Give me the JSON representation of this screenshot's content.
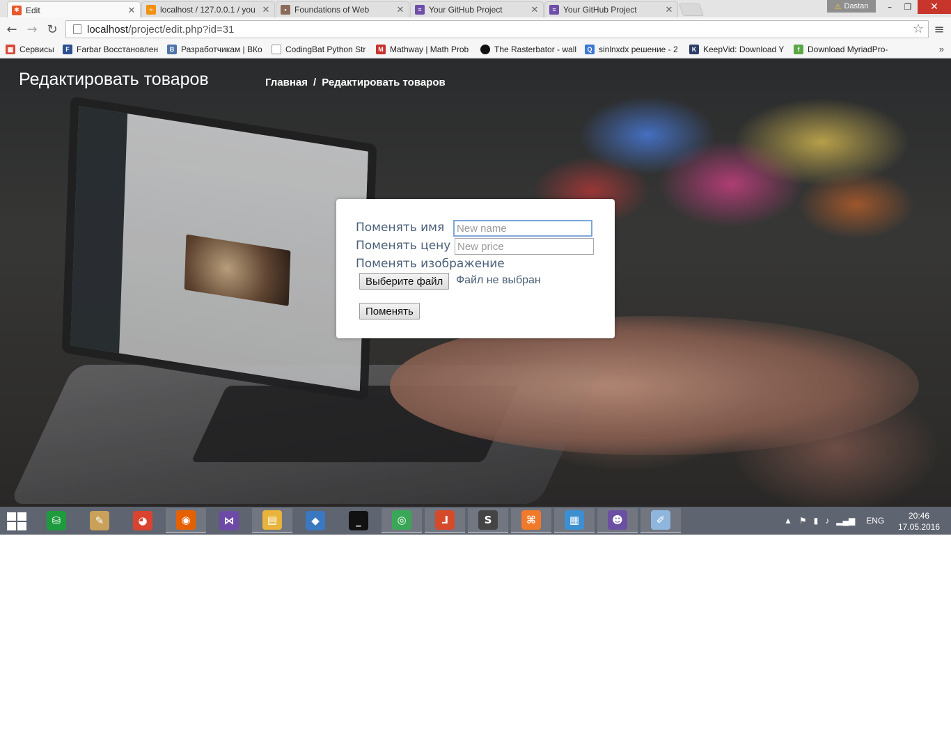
{
  "browser": {
    "tabs": [
      {
        "title": "Edit",
        "active": true,
        "favicon": "xampp-icon",
        "color": "#e8582a"
      },
      {
        "title": "localhost / 127.0.0.1 / you",
        "active": false,
        "favicon": "phpmyadmin-icon",
        "color": "#f29111"
      },
      {
        "title": "Foundations of Web",
        "active": false,
        "favicon": "course-icon",
        "color": "#8b6b5b"
      },
      {
        "title": "Your GitHub Project",
        "active": false,
        "favicon": "project-list-icon",
        "color": "#6f4ea8"
      },
      {
        "title": "Your GitHub Project",
        "active": false,
        "favicon": "project-list-icon",
        "color": "#6f4ea8"
      }
    ],
    "user_name": "Dastan",
    "address": {
      "host": "localhost",
      "path": "/project/edit.php?id=31"
    },
    "bookmarks": [
      {
        "label": "Сервисы",
        "icon": "apps-grid-icon",
        "color": "#d64a3a"
      },
      {
        "label": "Farbar Восстановлен",
        "icon": "bookmark-farbar-icon",
        "color": "#2b4f91"
      },
      {
        "label": "Разработчикам | ВКо",
        "icon": "vk-icon",
        "color": "#4f74a8"
      },
      {
        "label": "CodingBat Python Str",
        "icon": "page-icon",
        "color": "#aaaaaa"
      },
      {
        "label": "Mathway | Math Prob",
        "icon": "mathway-icon",
        "color": "#c8312c"
      },
      {
        "label": "The Rasterbator - wall",
        "icon": "rasterbator-icon",
        "color": "#111111"
      },
      {
        "label": "sinlnxdx решение - 2",
        "icon": "search-icon",
        "color": "#3a78d6"
      },
      {
        "label": "KeepVid: Download Y",
        "icon": "keepvid-icon",
        "color": "#2c3e66"
      },
      {
        "label": "Download MyriadPro-",
        "icon": "font-download-icon",
        "color": "#5aa845"
      }
    ]
  },
  "page": {
    "title": "Редактировать товаров",
    "breadcrumb": {
      "home": "Главная",
      "separator": "/",
      "current": "Редактировать товаров"
    }
  },
  "form": {
    "name_label": "Поменять имя",
    "name_placeholder": "New name",
    "price_label": "Поменять цену",
    "price_placeholder": "New price",
    "image_label": "Поменять изображение",
    "file_button": "Выберите файл",
    "file_status": "Файл не выбран",
    "submit": "Поменять"
  },
  "taskbar": {
    "apps": [
      {
        "icon": "store-icon",
        "color": "#1e9b3c",
        "glyph": "⛁",
        "open": false
      },
      {
        "icon": "paint-scroll-icon",
        "color": "#c9a15b",
        "glyph": "✎",
        "open": false
      },
      {
        "icon": "picasa-icon",
        "color": "#d9432f",
        "glyph": "◕",
        "open": false
      },
      {
        "icon": "firefox-icon",
        "color": "#e66000",
        "glyph": "◉",
        "open": true
      },
      {
        "icon": "visual-studio-icon",
        "color": "#6e4aa8",
        "glyph": "⋈",
        "open": false
      },
      {
        "icon": "file-explorer-icon",
        "color": "#e9b43b",
        "glyph": "▤",
        "open": true
      },
      {
        "icon": "virtualbox-icon",
        "color": "#3b78c2",
        "glyph": "◆",
        "open": false
      },
      {
        "icon": "command-prompt-icon",
        "color": "#111111",
        "glyph": "_",
        "open": false
      },
      {
        "icon": "chrome-icon",
        "color": "#3aa757",
        "glyph": "◎",
        "open": true
      },
      {
        "icon": "pdf-reader-icon",
        "color": "#d64a2c",
        "glyph": "⅃",
        "open": true
      },
      {
        "icon": "sublime-text-icon",
        "color": "#444444",
        "glyph": "S",
        "open": true
      },
      {
        "icon": "xampp-icon",
        "color": "#f07a2a",
        "glyph": "⌘",
        "open": true
      },
      {
        "icon": "control-panel-icon",
        "color": "#3c8fd0",
        "glyph": "▦",
        "open": true
      },
      {
        "icon": "github-desktop-icon",
        "color": "#6b4fa3",
        "glyph": "☻",
        "open": true
      },
      {
        "icon": "paint-icon",
        "color": "#8fb6dd",
        "glyph": "✐",
        "open": true
      }
    ],
    "language": "ENG",
    "time": "20:46",
    "date": "17.05.2016"
  }
}
